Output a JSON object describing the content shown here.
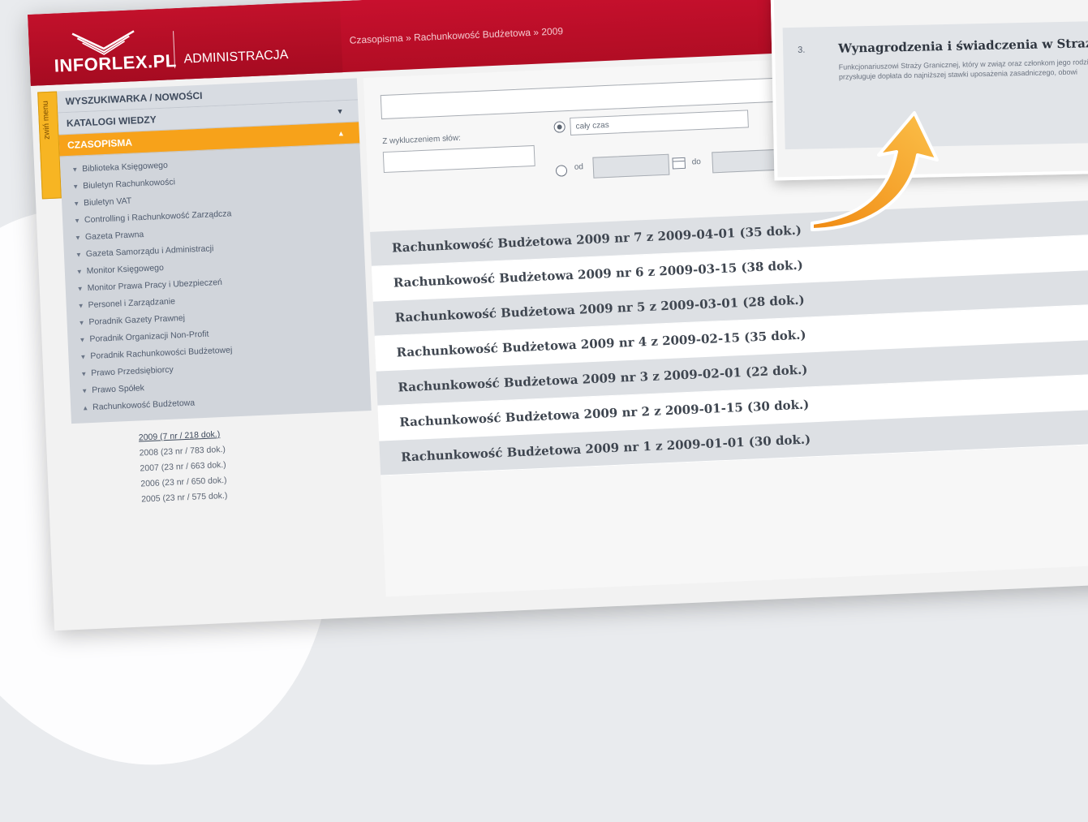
{
  "app": {
    "logo_text": "INFORLEX.PL",
    "logo_sub": "ADMINISTRACJA",
    "breadcrumb": "Czasopisma » Rachunkowość Budżetowa » 2009",
    "collapse_tab": "zwiń menu"
  },
  "sidebar": {
    "sections": [
      {
        "label": "WYSZUKIWARKA / NOWOŚCI"
      },
      {
        "label": "KATALOGI WIEDZY"
      },
      {
        "label": "CZASOPISMA"
      }
    ],
    "journals": [
      "Biblioteka Księgowego",
      "Biuletyn Rachunkowości",
      "Biuletyn VAT",
      "Controlling i Rachunkowość Zarządcza",
      "Gazeta Prawna",
      "Gazeta Samorządu i Administracji",
      "Monitor Księgowego",
      "Monitor Prawa Pracy i Ubezpieczeń",
      "Personel i Zarządzanie",
      "Poradnik Gazety Prawnej",
      "Poradnik Organizacji Non-Profit",
      "Poradnik Rachunkowości Budżetowej",
      "Prawo Przedsiębiorcy",
      "Prawo Spółek",
      "Rachunkowość Budżetowa"
    ],
    "years": [
      "2009 (7 nr / 218 dok.)",
      "2008 (23 nr / 783 dok.)",
      "2007 (23 nr / 663 dok.)",
      "2006 (23 nr / 650 dok.)",
      "2005 (23 nr / 575 dok.)"
    ]
  },
  "search": {
    "excluded_label": "Z wykluczeniem słów:",
    "period_option": "cały czas",
    "from_label": "od",
    "to_label": "do"
  },
  "results": [
    "Rachunkowość Budżetowa 2009 nr 7 z 2009-04-01 (35 dok.)",
    "Rachunkowość Budżetowa 2009 nr 6 z 2009-03-15 (38 dok.)",
    "Rachunkowość Budżetowa 2009 nr 5 z 2009-03-01 (28 dok.)",
    "Rachunkowość Budżetowa 2009 nr 4 z 2009-02-15 (35 dok.)",
    "Rachunkowość Budżetowa 2009 nr 3 z 2009-02-01 (22 dok.)",
    "Rachunkowość Budżetowa 2009 nr 2 z 2009-01-15 (30 dok.)",
    "Rachunkowość Budżetowa 2009 nr 1 z 2009-01-01 (30 dok.)"
  ],
  "callout": {
    "number": "3.",
    "title": "Wynagrodzenia i świadczenia w Straż",
    "text": "Funkcjonariuszowi Straży Granicznej, który w związ oraz członkom jego rodziny przysługuje dopłata do najniższej stawki uposażenia zasadniczego, obowi"
  },
  "colors": {
    "brand_red": "#c8102e",
    "accent_orange": "#f7a21a",
    "arrow_orange": "#f5a623"
  }
}
